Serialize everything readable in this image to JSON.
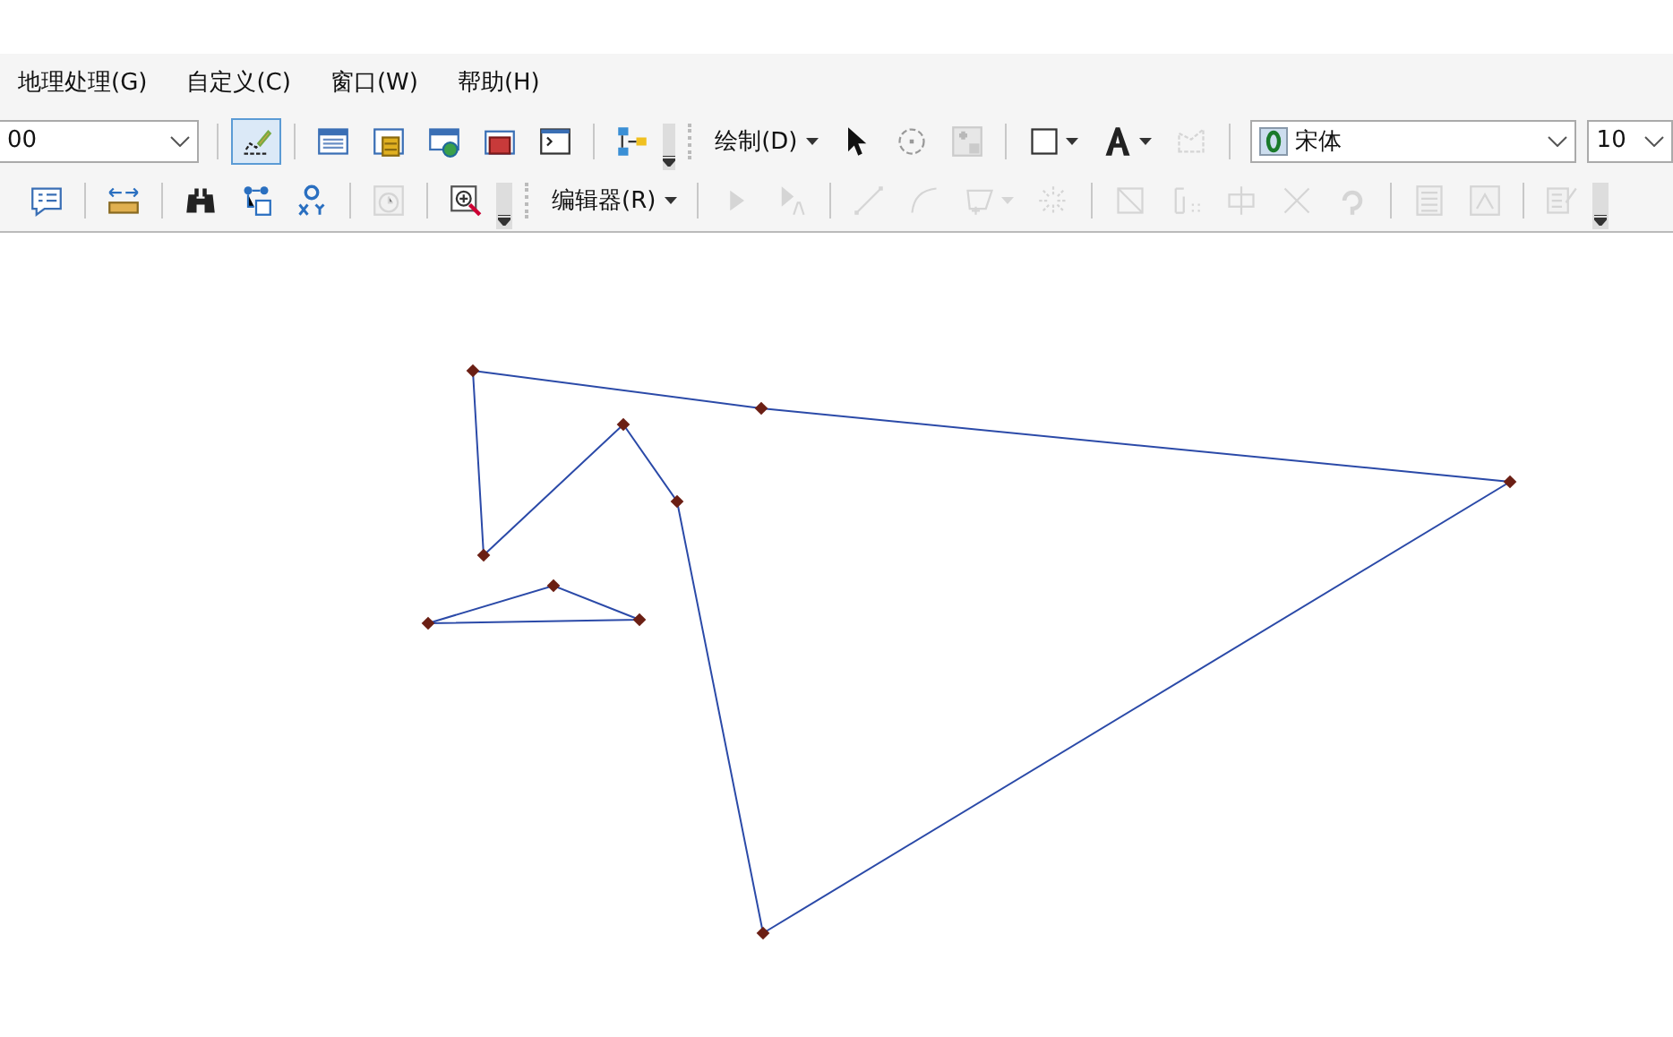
{
  "menu": [
    {
      "label": "地理处理(G)"
    },
    {
      "label": "自定义(C)"
    },
    {
      "label": "窗口(W)"
    },
    {
      "label": "帮助(H)"
    }
  ],
  "toolbar_1": {
    "scale_combo": {
      "value": "00"
    },
    "tools": [
      {
        "selected": true,
        "disabled": false
      },
      {
        "selected": false,
        "disabled": false
      },
      {
        "selected": false,
        "disabled": false
      },
      {
        "selected": false,
        "disabled": false
      },
      {
        "selected": false,
        "disabled": false
      },
      {
        "selected": false,
        "disabled": false
      },
      {
        "selected": false,
        "disabled": false
      }
    ],
    "draw_menu": {
      "label": "绘制(D)"
    },
    "draw_tools": [
      {
        "disabled": false
      },
      {
        "disabled": false
      },
      {
        "disabled": true
      },
      {
        "disabled": false
      },
      {
        "disabled": false
      },
      {
        "disabled": true
      }
    ],
    "font_combo": {
      "value": "宋体"
    },
    "size_combo": {
      "value": "10"
    }
  },
  "toolbar_2": {
    "tools": [
      {
        "disabled": false
      },
      {
        "disabled": false
      },
      {
        "disabled": false
      },
      {
        "disabled": false
      },
      {
        "disabled": false
      },
      {
        "disabled": true
      },
      {
        "disabled": false
      }
    ],
    "editor_menu": {
      "label": "编辑器(R)"
    },
    "edit_tools": [
      {
        "disabled": true
      },
      {
        "disabled": true
      },
      {
        "disabled": true
      },
      {
        "disabled": true
      },
      {
        "disabled": true
      },
      {
        "disabled": true
      },
      {
        "disabled": true
      },
      {
        "disabled": true
      },
      {
        "disabled": true
      },
      {
        "disabled": true
      },
      {
        "disabled": true
      },
      {
        "disabled": true
      },
      {
        "disabled": true
      },
      {
        "disabled": true
      }
    ]
  }
}
